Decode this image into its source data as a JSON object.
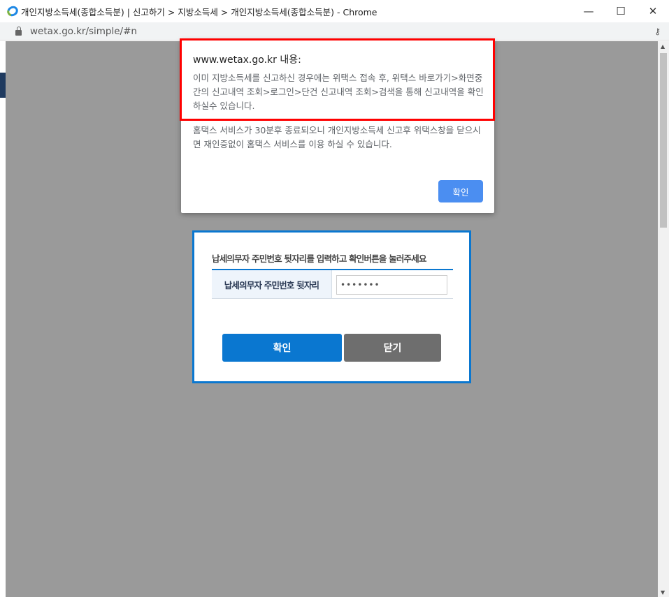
{
  "window": {
    "title": "개인지방소득세(종합소득분) | 신고하기 > 지방소득세 > 개인지방소득세(종합소득분) - Chrome",
    "url": "wetax.go.kr/simple/#n"
  },
  "alert": {
    "title": "www.wetax.go.kr 내용:",
    "message1": "이미 지방소득세를 신고하신 경우에는 위택스 접속 후, 위택스 바로가기>화면중간의 신고내역 조회>로그인>단건 신고내역 조회>검색을 통해 신고내역을 확인하실수 있습니다.",
    "message2": "홈택스 서비스가 30분후 종료되오니 개인지방소득세 신고후 위택스창을 닫으시면 재인증없이 홈택스 서비스를 이용 하실 수 있습니다.",
    "ok_label": "확인"
  },
  "modal": {
    "instruction": "납세의무자 주민번호 뒷자리를 입력하고 확인버튼을 눌러주세요",
    "field_label": "납세의무자 주민번호 뒷자리",
    "field_value": "•••••••",
    "confirm_label": "확인",
    "close_label": "닫기"
  },
  "colors": {
    "highlight": "#ff0000",
    "primary": "#0a77d0",
    "alert_button": "#4b8ef1"
  }
}
